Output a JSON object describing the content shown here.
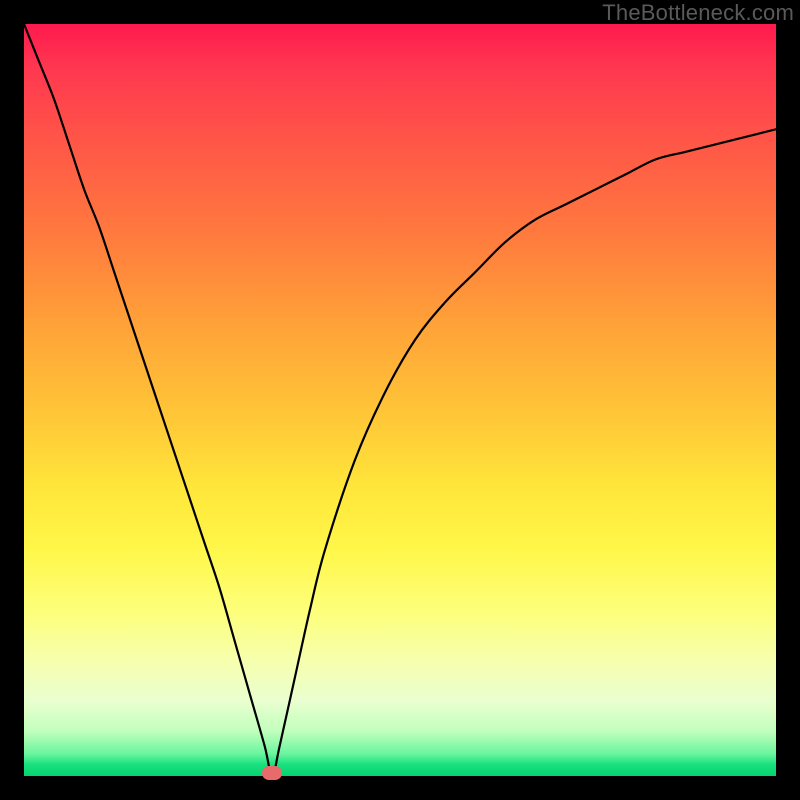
{
  "watermark": "TheBottleneck.com",
  "chart_data": {
    "type": "line",
    "title": "",
    "xlabel": "",
    "ylabel": "",
    "xlim": [
      0,
      100
    ],
    "ylim": [
      0,
      100
    ],
    "x": [
      0,
      2,
      4,
      6,
      8,
      10,
      12,
      14,
      16,
      18,
      20,
      22,
      24,
      26,
      28,
      30,
      32,
      33,
      34,
      36,
      38,
      40,
      44,
      48,
      52,
      56,
      60,
      64,
      68,
      72,
      76,
      80,
      84,
      88,
      92,
      96,
      100
    ],
    "values": [
      100,
      95,
      90,
      84,
      78,
      73,
      67,
      61,
      55,
      49,
      43,
      37,
      31,
      25,
      18,
      11,
      4,
      0,
      4,
      13,
      22,
      30,
      42,
      51,
      58,
      63,
      67,
      71,
      74,
      76,
      78,
      80,
      82,
      83,
      84,
      85,
      86
    ],
    "marker": {
      "x": 33,
      "y": 0
    },
    "background_gradient": {
      "top": "#ff1a4e",
      "mid_upper": "#ffa238",
      "mid": "#ffe73a",
      "mid_lower": "#f6ffb0",
      "bottom": "#06d36f"
    }
  }
}
